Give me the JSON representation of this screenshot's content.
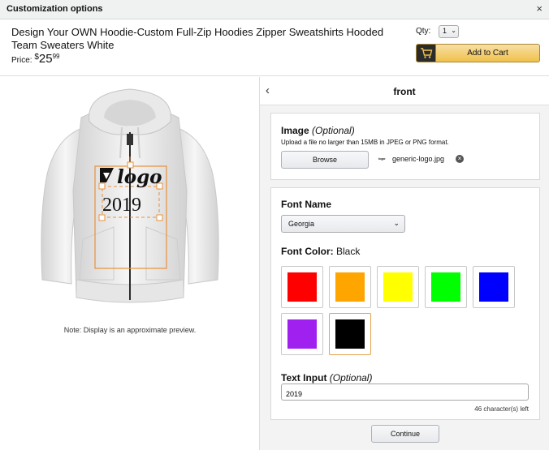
{
  "window": {
    "title": "Customization options",
    "close_symbol": "×"
  },
  "product": {
    "title": "Design Your OWN Hoodie-Custom Full-Zip Hoodies Zipper Sweatshirts Hooded Team Sweaters White",
    "price_label": "Price:",
    "price_symbol": "$",
    "price_whole": "25",
    "price_fraction": "99"
  },
  "qty": {
    "label": "Qty:",
    "value": "1"
  },
  "cart": {
    "label": "Add to Cart"
  },
  "preview": {
    "logo_text": "logo",
    "custom_text": "2019",
    "note": "Note: Display is an approximate preview."
  },
  "panel": {
    "back_symbol": "‹",
    "title": "front"
  },
  "image_section": {
    "title": "Image",
    "optional": "(Optional)",
    "help": "Upload a file no larger than 15MB in JPEG or PNG format.",
    "browse_label": "Browse",
    "thumb_text": "logo",
    "file_name": "generic-logo.jpg",
    "remove_symbol": "×"
  },
  "font_section": {
    "name_title": "Font Name",
    "selected_font": "Georgia",
    "color_title": "Font Color:",
    "selected_color": "Black",
    "swatches": [
      {
        "name": "Red",
        "color": "#ff0000"
      },
      {
        "name": "Orange",
        "color": "#ffa500"
      },
      {
        "name": "Yellow",
        "color": "#ffff00"
      },
      {
        "name": "Green",
        "color": "#00ff00"
      },
      {
        "name": "Blue",
        "color": "#0000ff"
      },
      {
        "name": "Purple",
        "color": "#a020f0"
      },
      {
        "name": "Black",
        "color": "#000000"
      }
    ]
  },
  "text_section": {
    "title": "Text Input",
    "optional": "(Optional)",
    "value": "2019",
    "char_left": "46 character(s) left"
  },
  "continue_label": "Continue",
  "colors": {
    "accent": "#f0c14b",
    "selection": "#e3a44e"
  }
}
